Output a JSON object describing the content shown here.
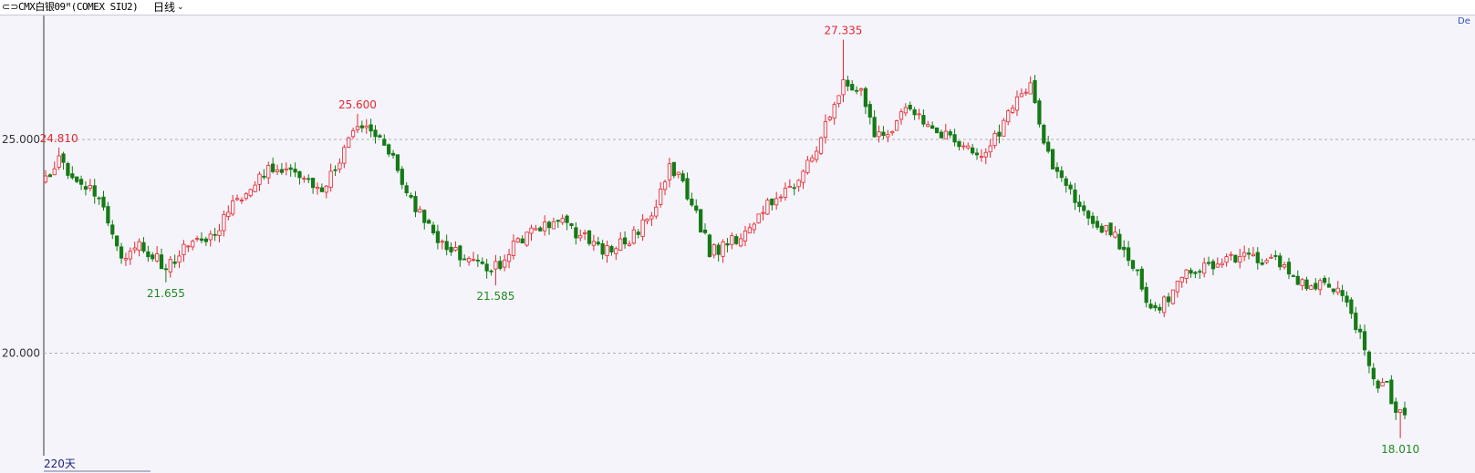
{
  "header": {
    "link_icon": "⊂⊃",
    "instrument": "CMX白银09ᴹ(COMEX SIU2)",
    "period": "日线",
    "chevron": "⌄"
  },
  "corner_text": "De",
  "days_label": "220天",
  "colors": {
    "up": "#e8262e",
    "down": "#157a15",
    "bg": "#f5f4fb",
    "grid": "#b0b0b0"
  },
  "chart_data": {
    "type": "candlestick",
    "ylim": [
      17.6,
      27.9
    ],
    "yticks": [
      {
        "value": 20.0,
        "label": "20.000"
      },
      {
        "value": 25.0,
        "label": "25.000"
      }
    ],
    "annotations": [
      {
        "label": "24.810",
        "value": 24.81,
        "index": 3,
        "kind": "high"
      },
      {
        "label": "21.655",
        "value": 21.655,
        "index": 27,
        "kind": "low"
      },
      {
        "label": "25.600",
        "value": 25.6,
        "index": 70,
        "kind": "high"
      },
      {
        "label": "21.585",
        "value": 21.585,
        "index": 101,
        "kind": "low"
      },
      {
        "label": "27.335",
        "value": 27.335,
        "index": 179,
        "kind": "high"
      },
      {
        "label": "18.010",
        "value": 18.01,
        "index": 304,
        "kind": "low"
      }
    ],
    "pivots": [
      [
        0,
        24.05
      ],
      [
        3,
        24.5
      ],
      [
        7,
        24.1
      ],
      [
        12,
        23.6
      ],
      [
        17,
        22.3
      ],
      [
        22,
        22.5
      ],
      [
        27,
        22.0
      ],
      [
        33,
        22.6
      ],
      [
        38,
        22.8
      ],
      [
        42,
        23.5
      ],
      [
        46,
        23.9
      ],
      [
        50,
        24.3
      ],
      [
        54,
        24.4
      ],
      [
        58,
        24.0
      ],
      [
        62,
        23.9
      ],
      [
        66,
        24.5
      ],
      [
        70,
        25.3
      ],
      [
        74,
        25.2
      ],
      [
        78,
        24.5
      ],
      [
        82,
        23.5
      ],
      [
        86,
        23.0
      ],
      [
        90,
        22.4
      ],
      [
        94,
        22.3
      ],
      [
        98,
        22.1
      ],
      [
        101,
        22.0
      ],
      [
        105,
        22.5
      ],
      [
        110,
        22.9
      ],
      [
        115,
        23.2
      ],
      [
        118,
        22.9
      ],
      [
        122,
        22.6
      ],
      [
        126,
        22.4
      ],
      [
        130,
        22.6
      ],
      [
        134,
        23.0
      ],
      [
        137,
        23.4
      ],
      [
        140,
        24.3
      ],
      [
        143,
        24.0
      ],
      [
        146,
        23.2
      ],
      [
        149,
        22.4
      ],
      [
        153,
        22.5
      ],
      [
        157,
        22.9
      ],
      [
        161,
        23.4
      ],
      [
        165,
        23.6
      ],
      [
        168,
        24.0
      ],
      [
        172,
        24.6
      ],
      [
        176,
        25.5
      ],
      [
        179,
        26.4
      ],
      [
        183,
        26.2
      ],
      [
        186,
        25.1
      ],
      [
        190,
        25.2
      ],
      [
        194,
        25.8
      ],
      [
        198,
        25.3
      ],
      [
        202,
        25.1
      ],
      [
        206,
        24.8
      ],
      [
        210,
        24.7
      ],
      [
        214,
        25.1
      ],
      [
        218,
        26.0
      ],
      [
        221,
        26.2
      ],
      [
        224,
        24.9
      ],
      [
        228,
        24.0
      ],
      [
        232,
        23.5
      ],
      [
        236,
        23.0
      ],
      [
        240,
        22.7
      ],
      [
        244,
        22.1
      ],
      [
        247,
        21.3
      ],
      [
        250,
        21.0
      ],
      [
        253,
        21.5
      ],
      [
        257,
        21.9
      ],
      [
        261,
        22.0
      ],
      [
        265,
        22.2
      ],
      [
        269,
        22.3
      ],
      [
        273,
        22.2
      ],
      [
        277,
        22.1
      ],
      [
        281,
        21.6
      ],
      [
        285,
        21.6
      ],
      [
        289,
        21.5
      ],
      [
        292,
        21.3
      ],
      [
        295,
        20.4
      ],
      [
        298,
        19.3
      ],
      [
        301,
        19.2
      ],
      [
        303,
        18.7
      ],
      [
        305,
        18.7
      ]
    ],
    "count": 306
  }
}
